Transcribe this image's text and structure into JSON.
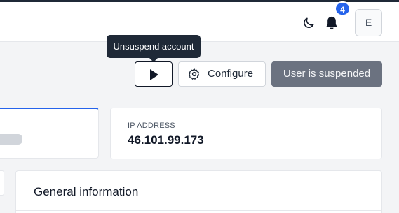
{
  "header": {
    "theme_toggle_icon": "moon-icon",
    "notifications_icon": "bell-icon",
    "notifications_count": "4",
    "avatar_initial": "E"
  },
  "actions": {
    "tooltip": "Unsuspend account",
    "unsuspend_icon": "play-icon",
    "configure_label": "Configure",
    "configure_icon": "gear-icon",
    "status_label": "User is suspended"
  },
  "info": {
    "ip_label": "IP ADDRESS",
    "ip_value": "46.101.99.173"
  },
  "general": {
    "title": "General information"
  },
  "colors": {
    "accent": "#2563eb",
    "badge": "#2563eb",
    "suspended_bg": "#6b7280",
    "tooltip_bg": "#1f2937"
  }
}
